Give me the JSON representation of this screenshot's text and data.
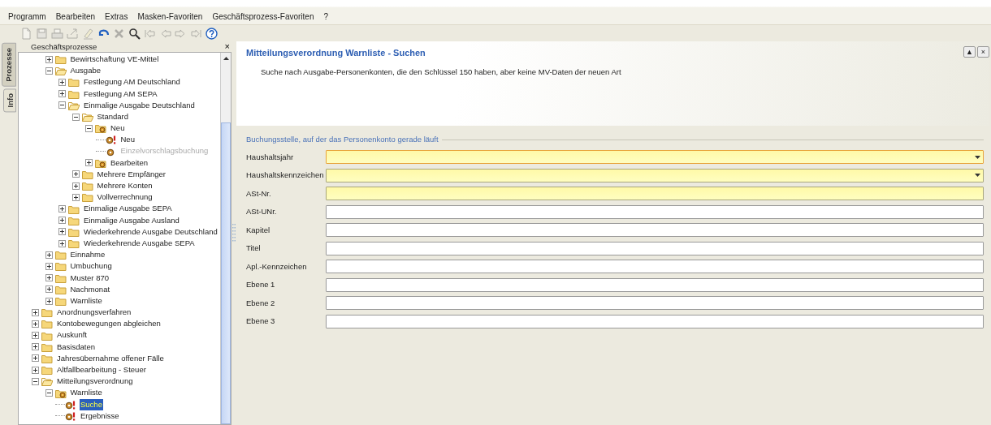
{
  "menu": [
    {
      "label": "Programm"
    },
    {
      "label": "Bearbeiten"
    },
    {
      "label": "Extras"
    },
    {
      "label": "Masken-Favoriten"
    },
    {
      "label": "Geschäftsprozess-Favoriten"
    },
    {
      "label": "?"
    }
  ],
  "toolbar": [
    {
      "kind": "new",
      "disabled": true
    },
    {
      "kind": "save",
      "disabled": true
    },
    {
      "kind": "print",
      "disabled": true
    },
    {
      "kind": "export",
      "disabled": true
    },
    {
      "kind": "eraser",
      "disabled": true
    },
    {
      "kind": "undo",
      "disabled": false
    },
    {
      "kind": "delete",
      "disabled": true
    },
    {
      "kind": "search",
      "disabled": false
    },
    {
      "kind": "first",
      "disabled": true
    },
    {
      "kind": "previous",
      "disabled": true
    },
    {
      "kind": "next",
      "disabled": true
    },
    {
      "kind": "last",
      "disabled": true
    },
    {
      "kind": "help",
      "disabled": false
    }
  ],
  "side_tabs": [
    {
      "label": "Prozesse",
      "selected": true
    },
    {
      "label": "Info",
      "selected": false
    }
  ],
  "tree_panel": {
    "title": "Geschäftsprozesse",
    "close": "×"
  },
  "tree": [
    {
      "children": [
        {
          "label": "Bewirtschaftung VE-Mittel",
          "kind": "folder",
          "expanded": false
        },
        {
          "label": "Ausgabe",
          "kind": "folder",
          "expanded": true,
          "children": [
            {
              "label": "Festlegung AM Deutschland",
              "kind": "folder",
              "expanded": false
            },
            {
              "label": "Festlegung AM SEPA",
              "kind": "folder",
              "expanded": false
            },
            {
              "label": "Einmalige Ausgabe Deutschland",
              "kind": "folder",
              "expanded": true,
              "children": [
                {
                  "label": "Standard",
                  "kind": "folder",
                  "expanded": true,
                  "children": [
                    {
                      "label": "Neu",
                      "kind": "task-folder",
                      "expanded": true,
                      "children": [
                        {
                          "label": "Neu",
                          "kind": "task",
                          "disabled": false,
                          "selected": false
                        },
                        {
                          "label": "Einzelvorschlagsbuchung",
                          "kind": "step",
                          "disabled": true,
                          "selected": false
                        }
                      ]
                    },
                    {
                      "label": "Bearbeiten",
                      "kind": "task-folder",
                      "expanded": false
                    }
                  ]
                },
                {
                  "label": "Mehrere Empfänger",
                  "kind": "folder",
                  "expanded": false
                },
                {
                  "label": "Mehrere Konten",
                  "kind": "folder",
                  "expanded": false
                },
                {
                  "label": "Vollverrechnung",
                  "kind": "folder",
                  "expanded": false
                }
              ]
            },
            {
              "label": "Einmalige Ausgabe SEPA",
              "kind": "folder",
              "expanded": false
            },
            {
              "label": "Einmalige Ausgabe Ausland",
              "kind": "folder",
              "expanded": false
            },
            {
              "label": "Wiederkehrende Ausgabe Deutschland",
              "kind": "folder",
              "expanded": false
            },
            {
              "label": "Wiederkehrende Ausgabe SEPA",
              "kind": "folder",
              "expanded": false
            }
          ]
        },
        {
          "label": "Einnahme",
          "kind": "folder",
          "expanded": false
        },
        {
          "label": "Umbuchung",
          "kind": "folder",
          "expanded": false
        },
        {
          "label": "Muster 870",
          "kind": "folder",
          "expanded": false
        },
        {
          "label": "Nachmonat",
          "kind": "folder",
          "expanded": false
        },
        {
          "label": "Warnliste",
          "kind": "folder",
          "expanded": false
        }
      ]
    },
    {
      "label": "Anordnungsverfahren",
      "kind": "folder",
      "expanded": false
    },
    {
      "label": "Kontobewegungen abgleichen",
      "kind": "folder",
      "expanded": false
    },
    {
      "label": "Auskunft",
      "kind": "folder",
      "expanded": false
    },
    {
      "label": "Basisdaten",
      "kind": "folder",
      "expanded": false
    },
    {
      "label": "Jahresübernahme offener Fälle",
      "kind": "folder",
      "expanded": false
    },
    {
      "label": "Altfallbearbeitung - Steuer",
      "kind": "folder",
      "expanded": false
    },
    {
      "label": "Mitteilungsverordnung",
      "kind": "folder",
      "expanded": true,
      "children": [
        {
          "label": "Warnliste",
          "kind": "task-folder",
          "expanded": true,
          "children": [
            {
              "label": "Suche",
              "kind": "task",
              "disabled": false,
              "selected": true
            },
            {
              "label": "Ergebnisse",
              "kind": "task",
              "disabled": false,
              "selected": false
            }
          ]
        }
      ]
    }
  ],
  "form": {
    "title": "Mitteilungsverordnung Warnliste - Suchen",
    "description": "Suche nach Ausgabe-Personenkonten, die den Schlüssel 150 haben, aber keine MV-Daten der neuen Art",
    "collapse": "▲",
    "close": "×",
    "group_title": "Buchungsstelle, auf der das Personenkonto gerade läuft",
    "fields": [
      {
        "label": "Haushaltsjahr",
        "kind": "select",
        "required": true
      },
      {
        "label": "Haushaltskennzeichen",
        "kind": "select",
        "required": true
      },
      {
        "label": "ASt-Nr.",
        "kind": "text",
        "required": true
      },
      {
        "label": "ASt-UNr.",
        "kind": "text",
        "required": false
      },
      {
        "label": "Kapitel",
        "kind": "text",
        "required": false
      },
      {
        "label": "Titel",
        "kind": "text",
        "required": false
      },
      {
        "label": "Apl.-Kennzeichen",
        "kind": "text",
        "required": false
      },
      {
        "label": "Ebene 1",
        "kind": "text",
        "required": false
      },
      {
        "label": "Ebene 2",
        "kind": "text",
        "required": false
      },
      {
        "label": "Ebene 3",
        "kind": "text",
        "required": false
      }
    ]
  }
}
